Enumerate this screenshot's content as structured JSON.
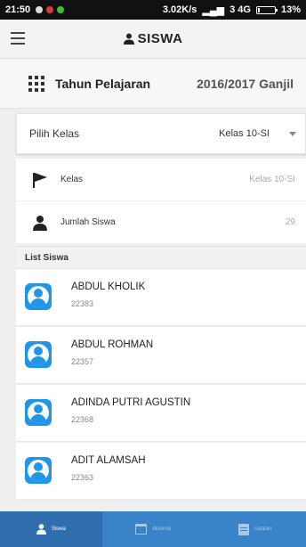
{
  "status_bar": {
    "time": "21:50",
    "network_speed": "3.02K/s",
    "network_type": "3 4G",
    "battery_percent": "13%",
    "battery_level": 0.13
  },
  "app_bar": {
    "title": "SISWA"
  },
  "academic_year": {
    "label": "Tahun Pelajaran",
    "value": "2016/2017 Ganjil"
  },
  "class_select": {
    "label": "Pilih Kelas",
    "selected": "Kelas 10-SI"
  },
  "info": {
    "kelas_label": "Kelas",
    "kelas_value": "Kelas 10-SI",
    "jumlah_label": "Jumlah Siswa",
    "jumlah_value": "29"
  },
  "list": {
    "header": "List Siswa",
    "students": [
      {
        "name": "ABDUL KHOLIK",
        "nis": "22383"
      },
      {
        "name": "ABDUL ROHMAN",
        "nis": "22357"
      },
      {
        "name": "ADINDA PUTRI AGUSTIN",
        "nis": "22368"
      },
      {
        "name": "ADIT ALAMSAH",
        "nis": "22363"
      }
    ]
  },
  "bottom_nav": {
    "items": [
      {
        "label": "Siswa",
        "icon": "person-icon"
      },
      {
        "label": "Absensi",
        "icon": "calendar-icon"
      },
      {
        "label": "catatan",
        "icon": "note-icon"
      }
    ]
  },
  "colors": {
    "accent": "#2196e8",
    "nav_bg": "#3b83c8",
    "nav_active": "#2f6fb0"
  }
}
